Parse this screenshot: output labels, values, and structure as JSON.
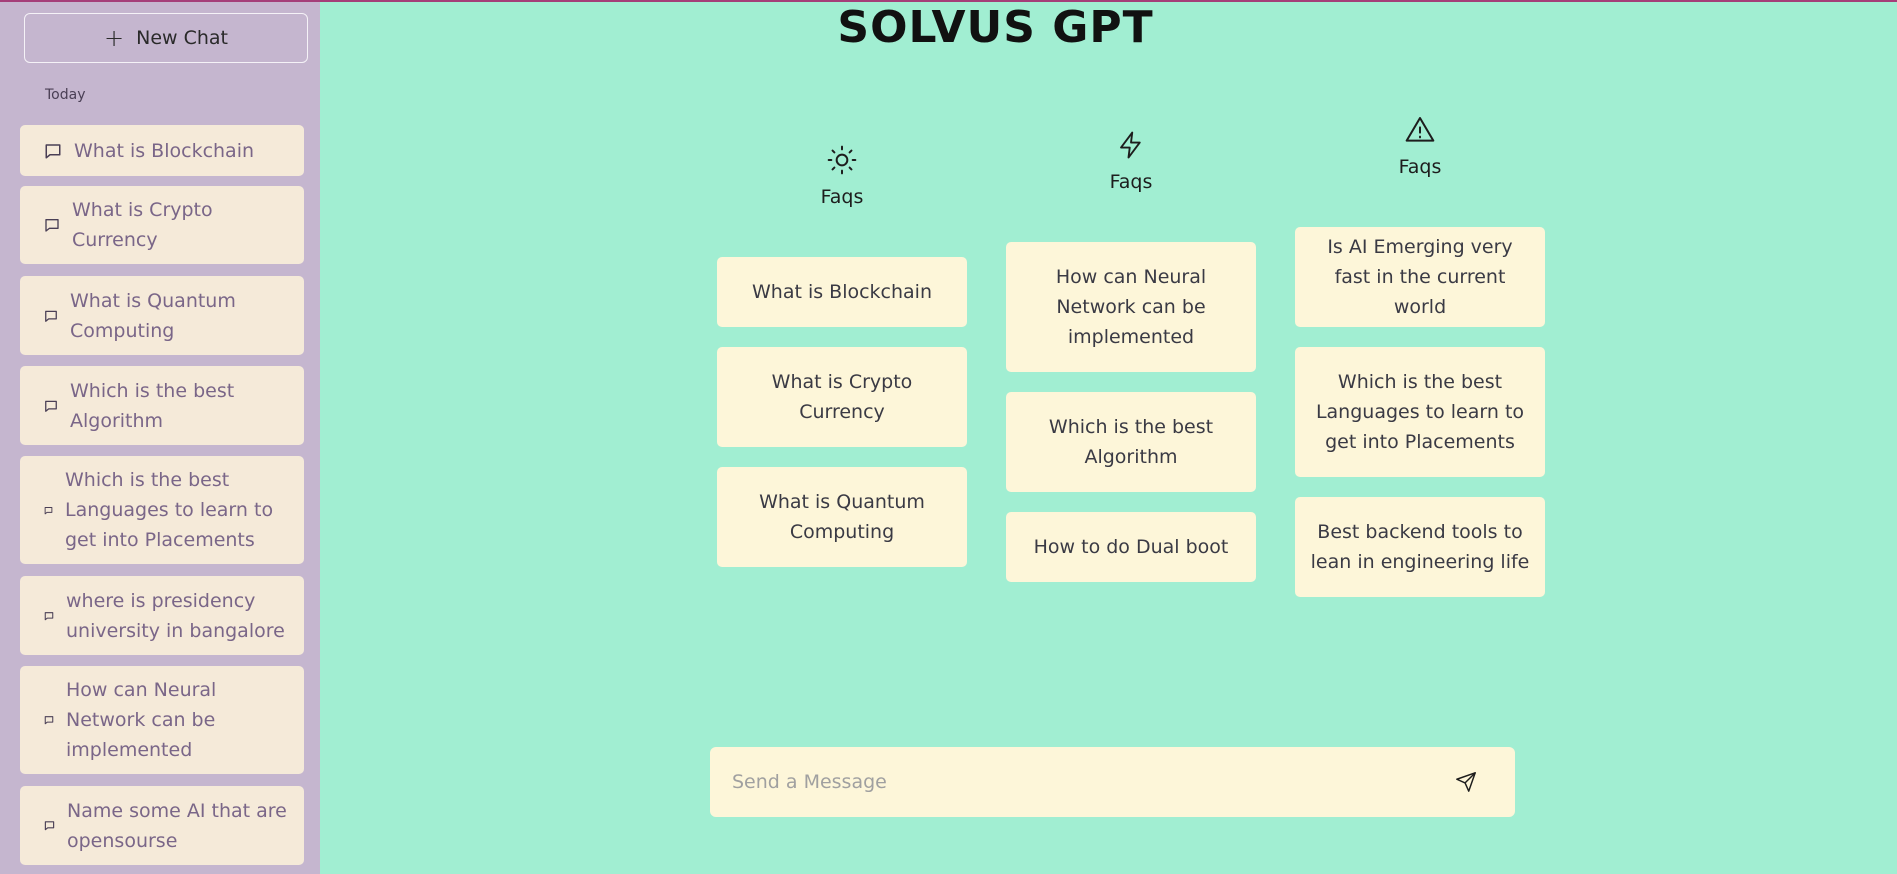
{
  "sidebar": {
    "new_chat_label": "New Chat",
    "section_label": "Today",
    "items": [
      {
        "label": "What is Blockchain"
      },
      {
        "label": "What is Crypto Currency"
      },
      {
        "label": "What is Quantum Computing"
      },
      {
        "label": "Which is the best Algorithm"
      },
      {
        "label": "Which is the best Languages to learn to get into Placements"
      },
      {
        "label": "where is presidency university in bangalore"
      },
      {
        "label": "How can Neural Network can be implemented"
      },
      {
        "label": "Name some AI that are opensourse"
      }
    ]
  },
  "main": {
    "title": "SOLVUS GPT",
    "columns": [
      {
        "icon": "sun-icon",
        "heading": "Faqs",
        "cards": [
          "What is Blockchain",
          "What is Crypto Currency",
          "What is Quantum Computing"
        ]
      },
      {
        "icon": "lightning-icon",
        "heading": "Faqs",
        "cards": [
          "How can Neural Network can be implemented",
          "Which is the best Algorithm",
          "How to do Dual boot"
        ]
      },
      {
        "icon": "warning-icon",
        "heading": "Faqs",
        "cards": [
          "Is AI Emerging very fast in the current world",
          "Which is the best Languages to learn to get into Placements",
          "Best backend tools to lean in engineering life"
        ]
      }
    ]
  },
  "composer": {
    "placeholder": "Send a Message",
    "value": ""
  },
  "colors": {
    "sidebar_bg": "#c5b6cf",
    "main_bg": "#a1eed2",
    "card_bg": "#fdf6d9",
    "history_item_bg": "#f5ead9"
  }
}
